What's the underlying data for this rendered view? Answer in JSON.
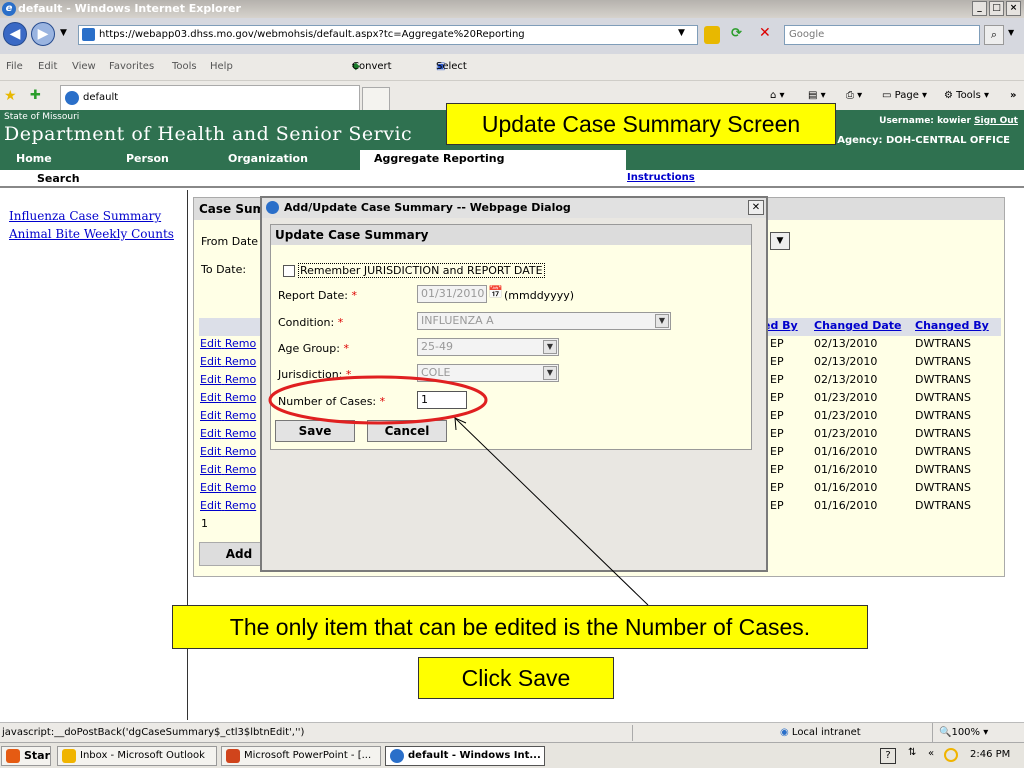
{
  "window": {
    "title": "default - Windows Internet Explorer"
  },
  "address": {
    "url": "https://webapp03.dhss.mo.gov/webmohsis/default.aspx?tc=Aggregate%20Reporting",
    "search_placeholder": "Google"
  },
  "menu": [
    "File",
    "Edit",
    "View",
    "Favorites",
    "Tools",
    "Help"
  ],
  "toolbar": {
    "convert": "Convert",
    "select": "Select"
  },
  "tab": {
    "label": "default"
  },
  "cmd": {
    "page": "Page",
    "tools": "Tools"
  },
  "site": {
    "state": "State of Missouri",
    "dept": "Department of Health and Senior Servic",
    "username_label": "Username:",
    "username": "kowier",
    "signout": "Sign Out",
    "agency": "Agency:  DOH-CENTRAL OFFICE"
  },
  "nav": {
    "home": "Home",
    "person": "Person",
    "organization": "Organization",
    "active": "Aggregate Reporting",
    "search": "Search",
    "instructions": "Instructions"
  },
  "left": {
    "link1": "Influenza Case Summary",
    "link2": "Animal Bite Weekly Counts"
  },
  "panel": {
    "title": "Case Sum",
    "from_label": "From Date",
    "to_label": "To Date:",
    "edit": "Edit",
    "remove": "Remo",
    "page_num": "1",
    "add": "Add",
    "headers": [
      "ed By",
      "Changed Date",
      "Changed By"
    ],
    "rows": [
      [
        "EP",
        "02/13/2010",
        "DWTRANS"
      ],
      [
        "EP",
        "02/13/2010",
        "DWTRANS"
      ],
      [
        "EP",
        "02/13/2010",
        "DWTRANS"
      ],
      [
        "EP",
        "01/23/2010",
        "DWTRANS"
      ],
      [
        "EP",
        "01/23/2010",
        "DWTRANS"
      ],
      [
        "EP",
        "01/23/2010",
        "DWTRANS"
      ],
      [
        "EP",
        "01/16/2010",
        "DWTRANS"
      ],
      [
        "EP",
        "01/16/2010",
        "DWTRANS"
      ],
      [
        "EP",
        "01/16/2010",
        "DWTRANS"
      ],
      [
        "EP",
        "01/16/2010",
        "DWTRANS"
      ]
    ]
  },
  "dialog": {
    "title": "Add/Update Case Summary -- Webpage Dialog",
    "header": "Update Case Summary",
    "remember": "Remember JURISDICTION and REPORT DATE",
    "report_date_label": "Report Date:",
    "report_date": "01/31/2010",
    "date_hint": "(mmddyyyy)",
    "condition_label": "Condition:",
    "condition": "INFLUENZA A",
    "age_label": "Age Group:",
    "age": "25-49",
    "jurisdiction_label": "Jurisdiction:",
    "jurisdiction": "COLE",
    "cases_label": "Number of Cases:",
    "cases": "1",
    "required": "*",
    "save": "Save",
    "cancel": "Cancel"
  },
  "callouts": {
    "top": "Update Case Summary Screen",
    "middle": "The only item that can be edited is the Number of Cases.",
    "bottom": "Click Save"
  },
  "status": {
    "text": "javascript:__doPostBack('dgCaseSummary$_ctl3$lbtnEdit','')",
    "zone": "Local intranet",
    "zoom": "100%"
  },
  "taskbar": {
    "start": "Start",
    "items": [
      "Inbox - Microsoft Outlook",
      "Microsoft PowerPoint - [...",
      "default - Windows Int..."
    ],
    "clock": "2:46 PM"
  },
  "colors": {
    "banner": "#2f7150",
    "callout": "#ffff00",
    "circle": "#e02020"
  }
}
